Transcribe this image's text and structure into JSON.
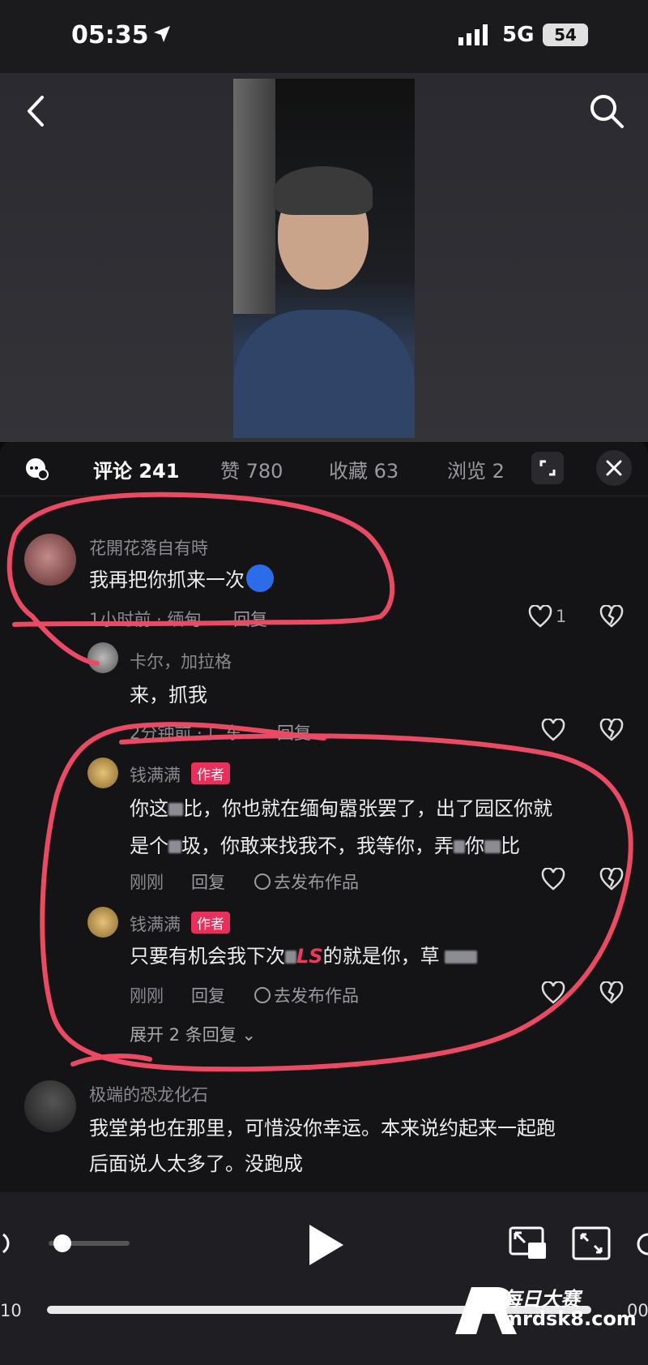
{
  "status_bar": {
    "time": "05:35",
    "network": "5G",
    "battery": "54"
  },
  "comments_panel": {
    "tabs": [
      {
        "label": "评论 241"
      },
      {
        "label": "赞 780"
      },
      {
        "label": "收藏 63"
      },
      {
        "label": "浏览 2"
      }
    ],
    "comments": [
      {
        "username": "花開花落自有時",
        "text": "我再把你抓来一次",
        "time_location": "1小时前 · 缅甸",
        "reply_label": "回复",
        "like_count": "1"
      },
      {
        "username": "卡尔，加拉格",
        "text": "来，抓我",
        "time_location": "2分钟前 · 广东",
        "reply_label": "回复"
      },
      {
        "username": "钱满满",
        "author_tag": "作者",
        "text_line1_a": "你这",
        "text_line1_b": "比，你也就在缅甸嚣张罢了，出了园区你就",
        "text_line2_a": "是个",
        "text_line2_b": "圾，你敢来找我不，我等你，弄",
        "text_line2_c": "你",
        "text_line2_d": "比",
        "time": "刚刚",
        "reply_label": "回复",
        "publish_label": "去发布作品"
      },
      {
        "username": "钱满满",
        "author_tag": "作者",
        "text_a": "只要有机会我下次",
        "text_ls": "LS",
        "text_b": "的就是你，草",
        "time": "刚刚",
        "reply_label": "回复",
        "publish_label": "去发布作品"
      },
      {
        "expand_label": "展开 2 条回复"
      },
      {
        "username": "极端的恐龙化石",
        "text_line1": "我堂弟也在那里，可惜没你幸运。本来说约起来一起跑",
        "text_line2": "后面说人太多了。没跑成"
      }
    ]
  },
  "player": {
    "current_time": "10",
    "end_time": "00",
    "progress": 0.83,
    "volume": 0.15
  },
  "watermark": {
    "title": "每日大赛",
    "url": "mrdsk8.com"
  },
  "colors": {
    "accent": "#e7305a",
    "annotation": "#ea4a64"
  }
}
